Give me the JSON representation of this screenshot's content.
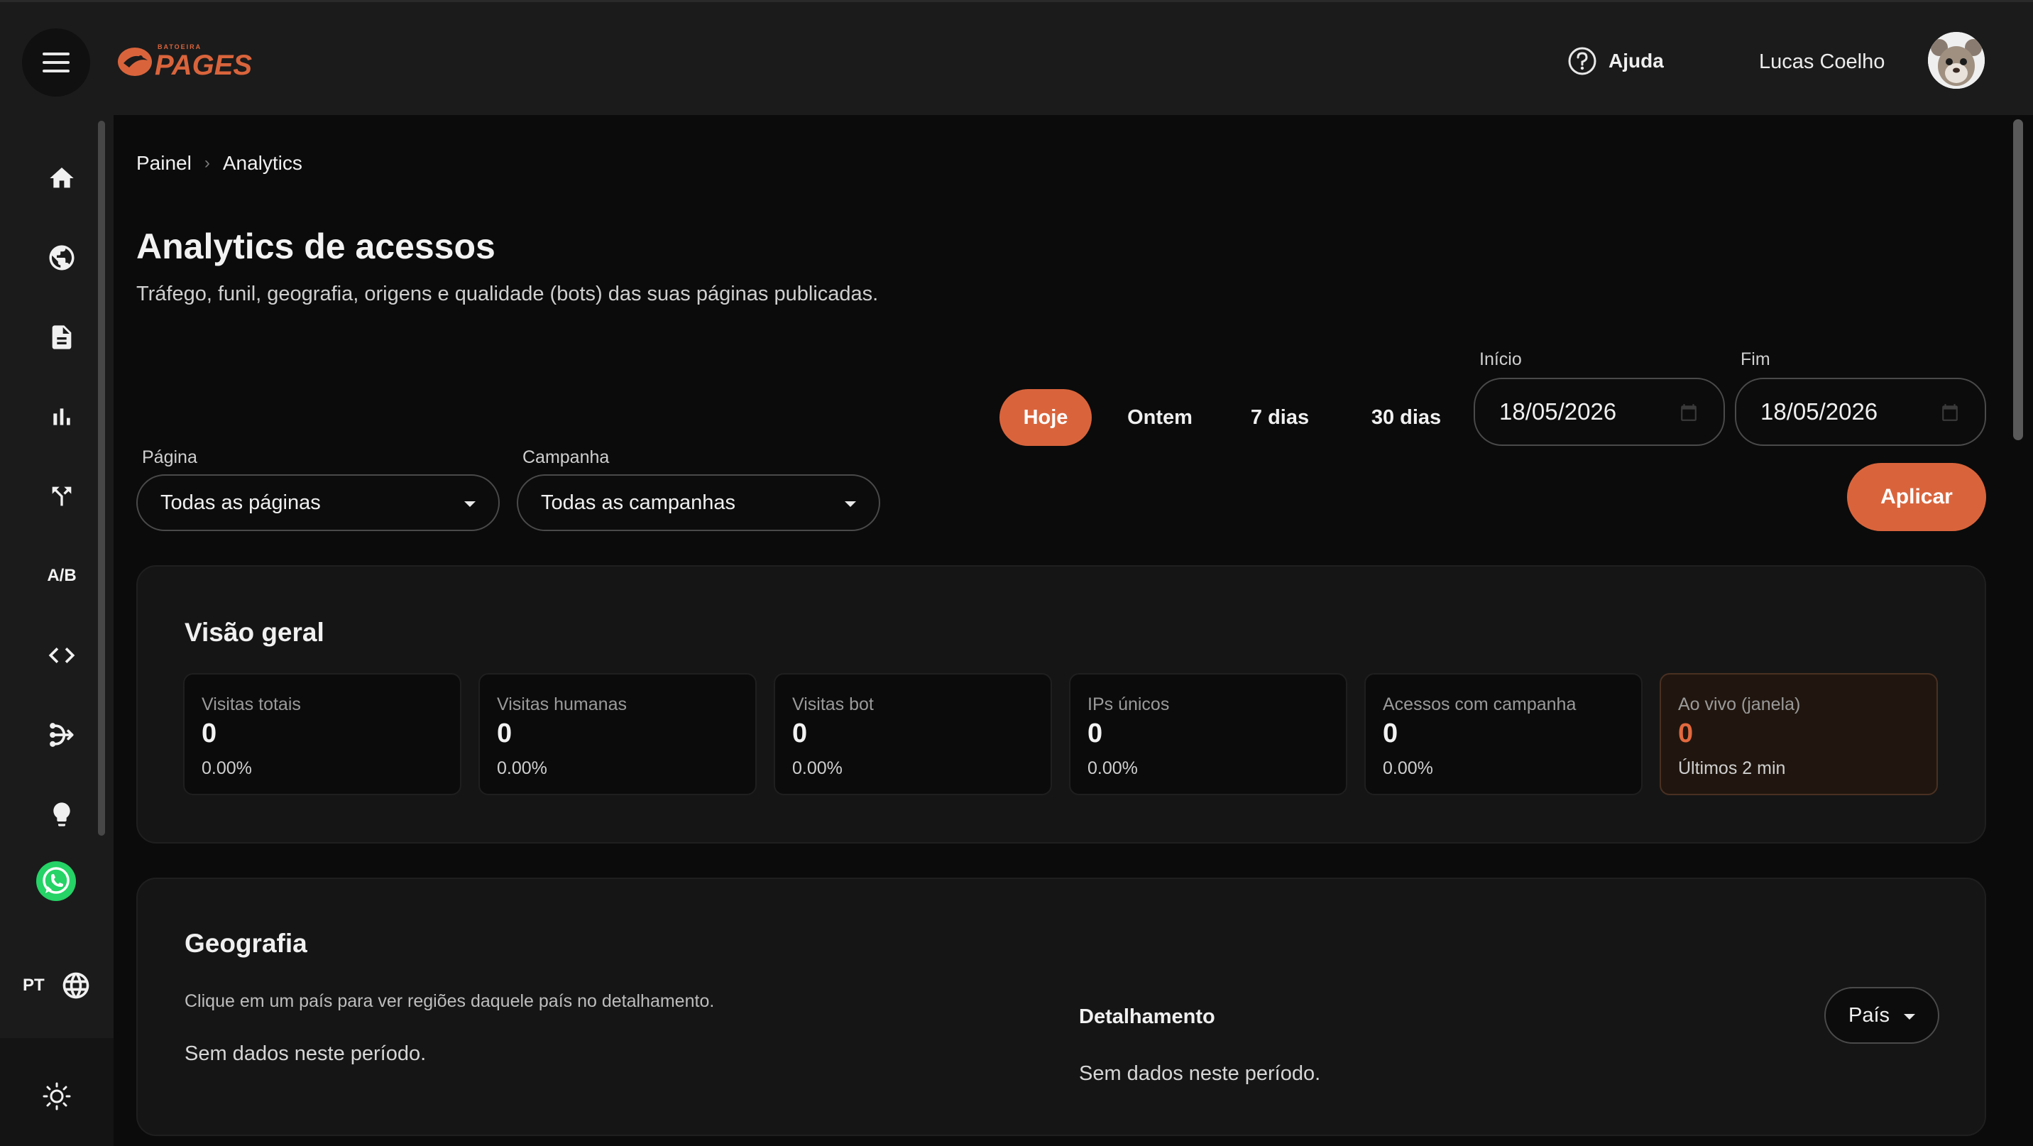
{
  "header": {
    "logo_small": "BATOEIRA",
    "logo_text": "PAGES",
    "help_label": "Ajuda",
    "user_name": "Lucas Coelho"
  },
  "sidebar": {
    "items": [
      {
        "icon": "home-icon"
      },
      {
        "icon": "globe-icon"
      },
      {
        "icon": "document-icon"
      },
      {
        "icon": "bar-chart-icon"
      },
      {
        "icon": "branch-icon"
      },
      {
        "icon": "ab-test-icon",
        "label": "A/B"
      },
      {
        "icon": "code-icon"
      },
      {
        "icon": "flow-icon"
      },
      {
        "icon": "lightbulb-icon"
      },
      {
        "icon": "whatsapp-icon"
      }
    ],
    "language_code": "PT"
  },
  "breadcrumb": {
    "first": "Painel",
    "separator": "›",
    "current": "Analytics"
  },
  "page": {
    "title": "Analytics de acessos",
    "subtitle": "Tráfego, funil, geografia, origens e qualidade (bots) das suas páginas publicadas."
  },
  "filters": {
    "ranges": [
      "Hoje",
      "Ontem",
      "7 dias",
      "30 dias"
    ],
    "active_range": "Hoje",
    "start_label": "Início",
    "start_value": "18/05/2026",
    "end_label": "Fim",
    "end_value": "18/05/2026",
    "page_label": "Página",
    "page_value": "Todas as páginas",
    "campaign_label": "Campanha",
    "campaign_value": "Todas as campanhas",
    "apply_label": "Aplicar"
  },
  "overview": {
    "title": "Visão geral",
    "stats": [
      {
        "label": "Visitas totais",
        "value": "0",
        "sub": "0.00%"
      },
      {
        "label": "Visitas humanas",
        "value": "0",
        "sub": "0.00%"
      },
      {
        "label": "Visitas bot",
        "value": "0",
        "sub": "0.00%"
      },
      {
        "label": "IPs únicos",
        "value": "0",
        "sub": "0.00%"
      },
      {
        "label": "Acessos com campanha",
        "value": "0",
        "sub": "0.00%"
      },
      {
        "label": "Ao vivo (janela)",
        "value": "0",
        "sub": "Últimos 2 min"
      }
    ]
  },
  "geography": {
    "title": "Geografia",
    "hint": "Clique em um país para ver regiões daquele país no detalhamento.",
    "empty": "Sem dados neste período.",
    "detail_title": "Detalhamento",
    "detail_select": "País",
    "detail_empty": "Sem dados neste período."
  },
  "colors": {
    "accent": "#d9643c",
    "background": "#0b0b0b",
    "panel": "#1b1b1b",
    "card": "#151515"
  }
}
